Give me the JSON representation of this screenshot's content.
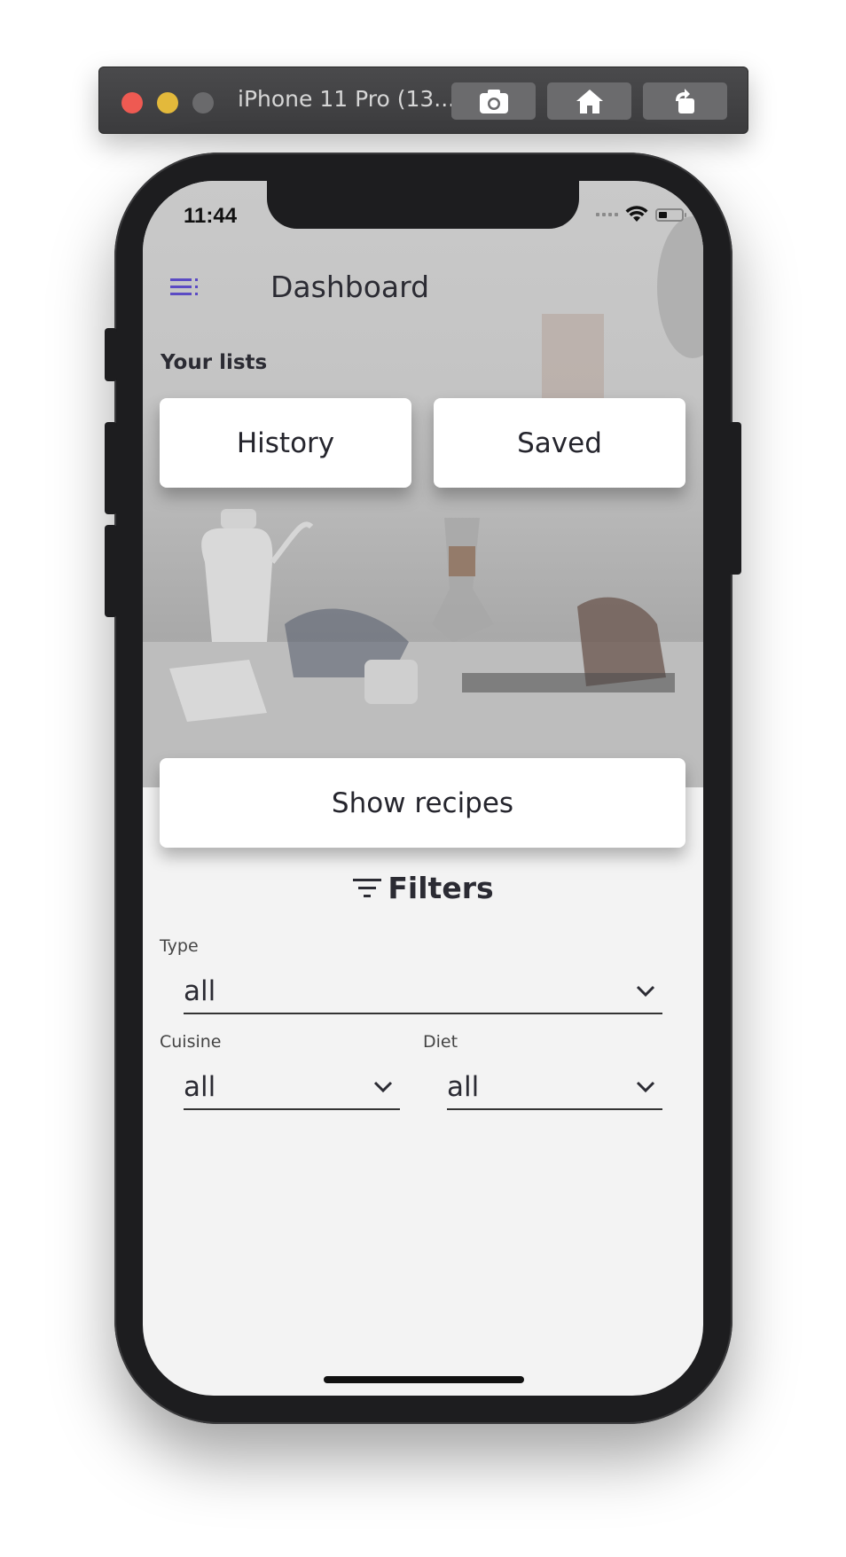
{
  "simulator": {
    "title": "iPhone 11 Pro (13....",
    "buttons": [
      "screenshot-icon",
      "home-icon",
      "rotate-icon"
    ]
  },
  "status_bar": {
    "time": "11:44"
  },
  "header": {
    "title": "Dashboard",
    "menu_icon": "menu-icon",
    "accent": "#5b4bc4"
  },
  "lists": {
    "label": "Your lists",
    "history": "History",
    "saved": "Saved"
  },
  "show_recipes": "Show recipes",
  "filters": {
    "title": "Filters",
    "type": {
      "label": "Type",
      "value": "all"
    },
    "cuisine": {
      "label": "Cuisine",
      "value": "all"
    },
    "diet": {
      "label": "Diet",
      "value": "all"
    }
  }
}
